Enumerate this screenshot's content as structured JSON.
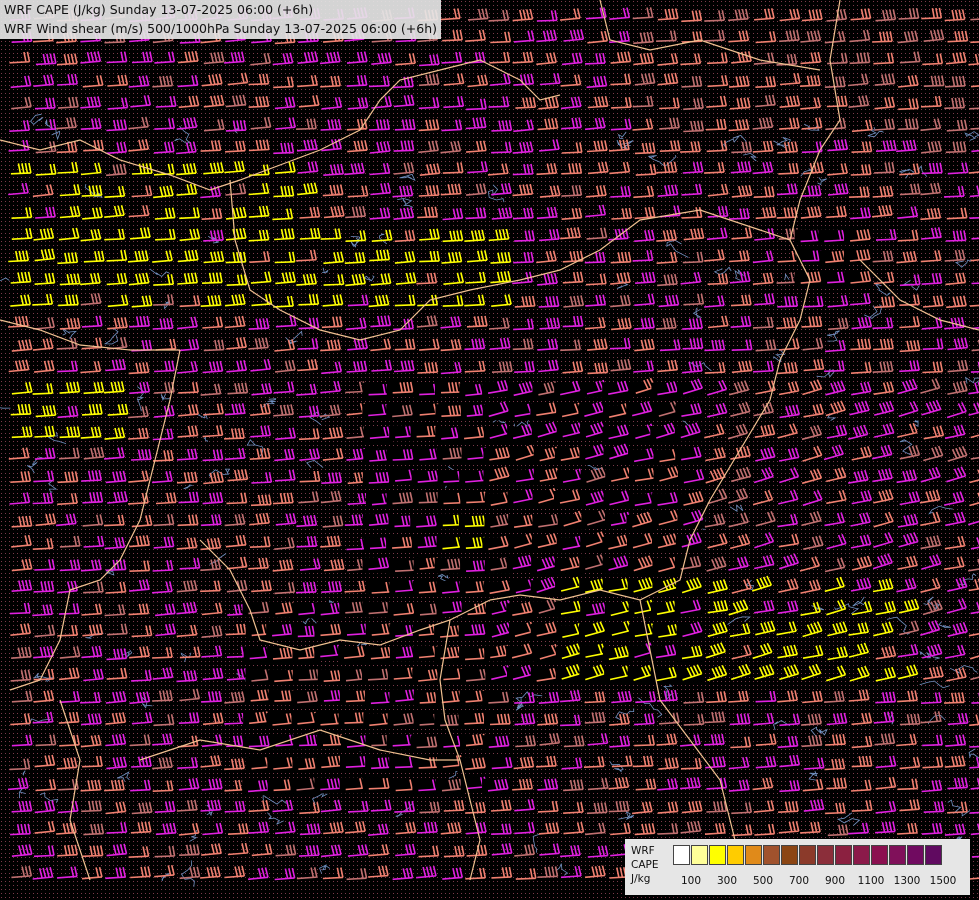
{
  "titles": {
    "line1": "WRF CAPE (J/kg) Sunday 13-07-2025 06:00 (+6h)",
    "line2": "WRF Wind shear (m/s) 500/1000hPa Sunday 13-07-2025 06:00 (+6h)"
  },
  "legend": {
    "label1": "WRF",
    "label2": "CAPE",
    "label3": "J/kg",
    "ticks": [
      "100",
      "300",
      "500",
      "700",
      "900",
      "1100",
      "1300",
      "1500"
    ],
    "colors": [
      "#ffffff",
      "#ffff99",
      "#ffff00",
      "#ffcc00",
      "#e08a1a",
      "#a0522d",
      "#8b4513",
      "#8b3a2a",
      "#8b2e3a",
      "#8b2040",
      "#8b1a4a",
      "#8b1050",
      "#80105a",
      "#700a60",
      "#600a60"
    ]
  },
  "colors": {
    "barb_magenta": "#e020e0",
    "barb_salmon": "#f08070",
    "barb_yellow": "#ffff00",
    "barb_mauve": "#c07070",
    "border": "#f0c090",
    "contour": "#7090c0",
    "background": "#000000"
  }
}
